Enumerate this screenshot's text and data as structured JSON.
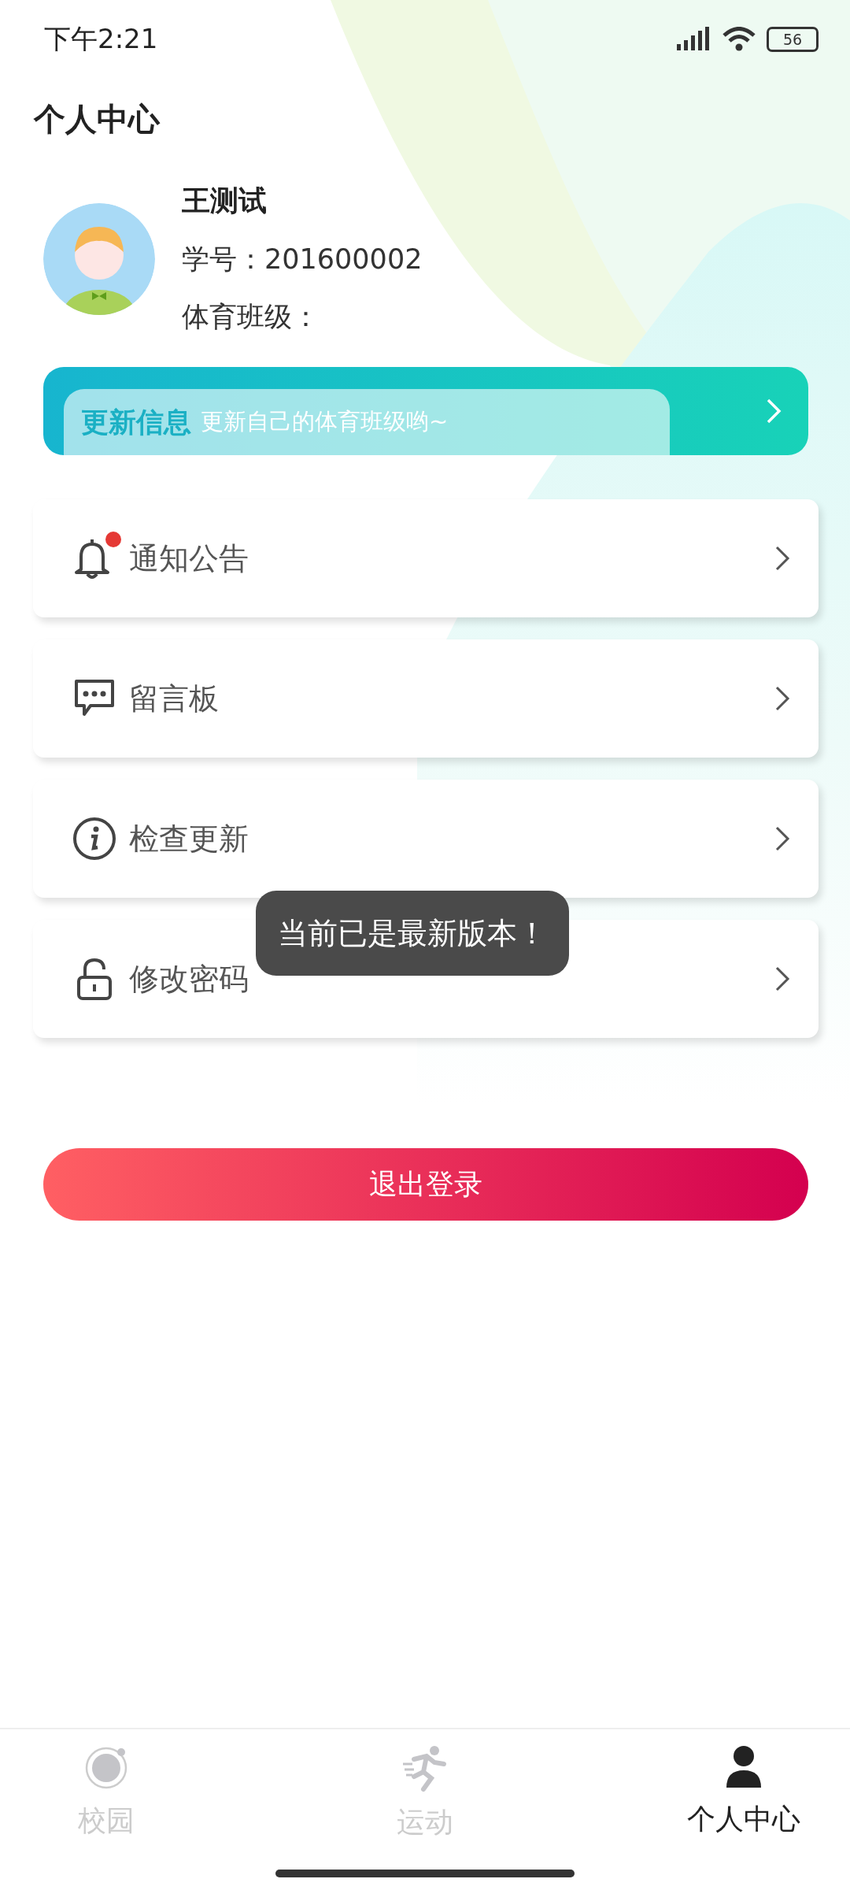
{
  "status_bar": {
    "time": "下午2:21",
    "battery": "56"
  },
  "title": "个人中心",
  "profile": {
    "name": "王测试",
    "student_id": "学号：201600002",
    "class": "体育班级："
  },
  "update_banner": {
    "title": "更新信息",
    "subtitle": "更新自己的体育班级哟~"
  },
  "menu": [
    {
      "kind": "bell",
      "label": "通知公告",
      "badge": true
    },
    {
      "kind": "message",
      "label": "留言板",
      "badge": false
    },
    {
      "kind": "info",
      "label": "检查更新",
      "badge": false
    },
    {
      "kind": "lock",
      "label": "修改密码",
      "badge": false
    }
  ],
  "toast": "当前已是最新版本！",
  "logout_button": "退出登录",
  "tab_bar": [
    {
      "kind": "campus",
      "label": "校园",
      "selected": false
    },
    {
      "kind": "sport",
      "label": "运动",
      "selected": false
    },
    {
      "kind": "person",
      "label": "个人中心",
      "selected": true
    }
  ]
}
